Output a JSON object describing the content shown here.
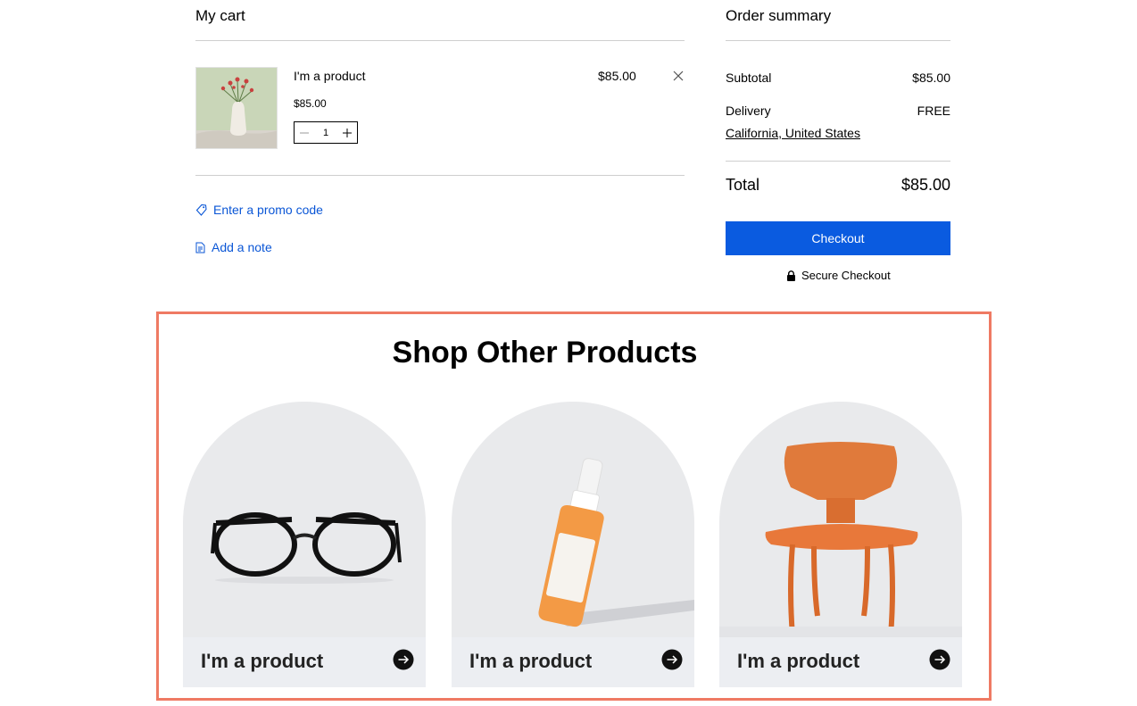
{
  "cart": {
    "title": "My cart",
    "item": {
      "name": "I'm a product",
      "unit_price": "$85.00",
      "quantity": "1",
      "line_total": "$85.00",
      "image_icon": "flower-vase-image"
    },
    "promo_label": "Enter a promo code",
    "note_label": "Add a note"
  },
  "summary": {
    "title": "Order summary",
    "subtotal_label": "Subtotal",
    "subtotal_value": "$85.00",
    "delivery_label": "Delivery",
    "delivery_value": "FREE",
    "location": "California, United States",
    "total_label": "Total",
    "total_value": "$85.00",
    "checkout_label": "Checkout",
    "secure_label": "Secure Checkout"
  },
  "shop_other": {
    "title": "Shop Other Products",
    "products": [
      {
        "name": "I'm a product",
        "image": "eyeglasses-image"
      },
      {
        "name": "I'm a product",
        "image": "serum-bottle-image"
      },
      {
        "name": "I'm a product",
        "image": "orange-chair-image"
      }
    ]
  },
  "colors": {
    "accent": "#0a5be0",
    "link": "#0a56d6",
    "highlight": "#ef7a63",
    "card_bg": "#e9eaec"
  }
}
